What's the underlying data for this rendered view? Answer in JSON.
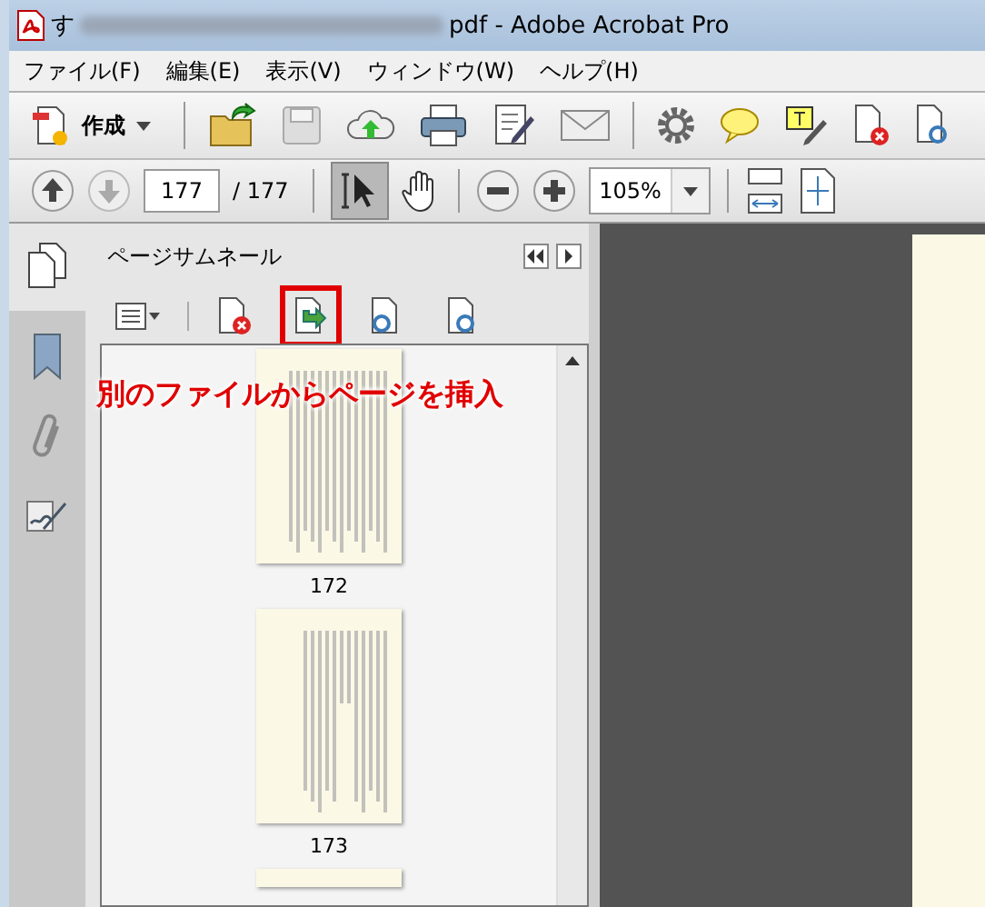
{
  "window": {
    "title_start": "す",
    "title": "pdf - Adobe Acrobat Pro"
  },
  "menu": [
    "ファイル(F)",
    "編集(E)",
    "表示(V)",
    "ウィンドウ(W)",
    "ヘルプ(H)"
  ],
  "toolbar": {
    "create_label": "作成"
  },
  "navigation": {
    "page": "177",
    "total": "/ 177",
    "zoom": "105%",
    "select_tool_selected": true
  },
  "panel": {
    "title": "ページサムネール",
    "annotation": "別のファイルからページを挿入"
  },
  "panel_tools": [
    {
      "kind": "options",
      "highlighted": false
    },
    {
      "kind": "delete",
      "highlighted": false
    },
    {
      "kind": "insert",
      "highlighted": true
    },
    {
      "kind": "rotate-left",
      "highlighted": false
    },
    {
      "kind": "rotate-right",
      "highlighted": false
    }
  ],
  "thumbnails": [
    {
      "label": "172"
    },
    {
      "label": "173"
    }
  ]
}
